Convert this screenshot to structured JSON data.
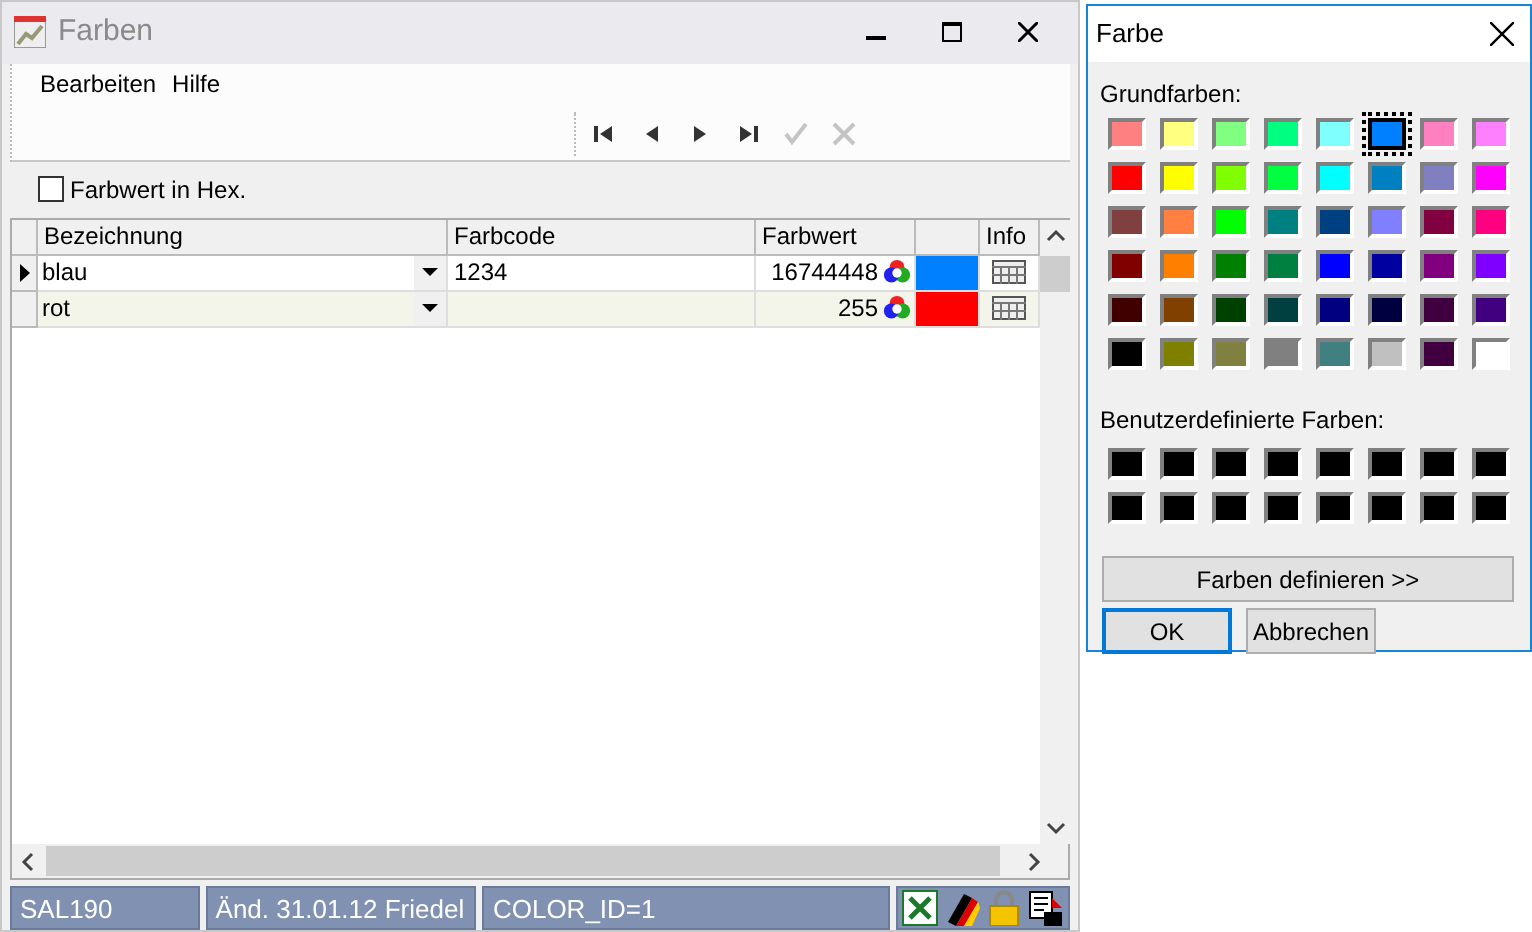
{
  "window": {
    "title": "Farben"
  },
  "menu": [
    {
      "label": "Bearbeiten"
    },
    {
      "label": "Hilfe"
    }
  ],
  "navigator": [
    {
      "kind": "first",
      "disabled": false
    },
    {
      "kind": "prev",
      "disabled": false
    },
    {
      "kind": "next",
      "disabled": false
    },
    {
      "kind": "last",
      "disabled": false
    },
    {
      "kind": "post",
      "disabled": true
    },
    {
      "kind": "cancel",
      "disabled": true
    }
  ],
  "hex_option": {
    "label": "Farbwert in Hex.",
    "checked": false
  },
  "table": {
    "columns": [
      "Bezeichnung",
      "Farbcode",
      "Farbwert",
      "Info"
    ],
    "rows": [
      {
        "name": "blau",
        "code": "1234",
        "value": "16744448",
        "color": "#0080ff",
        "selected": true
      },
      {
        "name": "rot",
        "code": "",
        "value": "255",
        "color": "#ff0000",
        "selected": false
      }
    ]
  },
  "status_bar": [
    "SAL190",
    "Änd. 31.01.12 Friedel",
    "COLOR_ID=1"
  ],
  "dialog": {
    "title": "Farbe",
    "basic_label": "Grundfarben:",
    "basic_colors": [
      {
        "color": "#ff8080",
        "selected": false
      },
      {
        "color": "#ffff80",
        "selected": false
      },
      {
        "color": "#80ff80",
        "selected": false
      },
      {
        "color": "#00ff80",
        "selected": false
      },
      {
        "color": "#80ffff",
        "selected": false
      },
      {
        "color": "#0080ff",
        "selected": true
      },
      {
        "color": "#ff80c0",
        "selected": false
      },
      {
        "color": "#ff80ff",
        "selected": false
      },
      {
        "color": "#ff0000",
        "selected": false
      },
      {
        "color": "#ffff00",
        "selected": false
      },
      {
        "color": "#80ff00",
        "selected": false
      },
      {
        "color": "#00ff40",
        "selected": false
      },
      {
        "color": "#00ffff",
        "selected": false
      },
      {
        "color": "#0080c0",
        "selected": false
      },
      {
        "color": "#8080c0",
        "selected": false
      },
      {
        "color": "#ff00ff",
        "selected": false
      },
      {
        "color": "#804040",
        "selected": false
      },
      {
        "color": "#ff8040",
        "selected": false
      },
      {
        "color": "#00ff00",
        "selected": false
      },
      {
        "color": "#008080",
        "selected": false
      },
      {
        "color": "#004080",
        "selected": false
      },
      {
        "color": "#8080ff",
        "selected": false
      },
      {
        "color": "#800040",
        "selected": false
      },
      {
        "color": "#ff0080",
        "selected": false
      },
      {
        "color": "#800000",
        "selected": false
      },
      {
        "color": "#ff8000",
        "selected": false
      },
      {
        "color": "#008000",
        "selected": false
      },
      {
        "color": "#008040",
        "selected": false
      },
      {
        "color": "#0000ff",
        "selected": false
      },
      {
        "color": "#0000a0",
        "selected": false
      },
      {
        "color": "#800080",
        "selected": false
      },
      {
        "color": "#8000ff",
        "selected": false
      },
      {
        "color": "#400000",
        "selected": false
      },
      {
        "color": "#804000",
        "selected": false
      },
      {
        "color": "#004000",
        "selected": false
      },
      {
        "color": "#004040",
        "selected": false
      },
      {
        "color": "#000080",
        "selected": false
      },
      {
        "color": "#000040",
        "selected": false
      },
      {
        "color": "#400040",
        "selected": false
      },
      {
        "color": "#400080",
        "selected": false
      },
      {
        "color": "#000000",
        "selected": false
      },
      {
        "color": "#808000",
        "selected": false
      },
      {
        "color": "#808040",
        "selected": false
      },
      {
        "color": "#808080",
        "selected": false
      },
      {
        "color": "#408080",
        "selected": false
      },
      {
        "color": "#c0c0c0",
        "selected": false
      },
      {
        "color": "#400040",
        "selected": false
      },
      {
        "color": "#ffffff",
        "selected": false
      }
    ],
    "custom_label": "Benutzerdefinierte Farben:",
    "custom_colors": [
      {
        "color": "#000000"
      },
      {
        "color": "#000000"
      },
      {
        "color": "#000000"
      },
      {
        "color": "#000000"
      },
      {
        "color": "#000000"
      },
      {
        "color": "#000000"
      },
      {
        "color": "#000000"
      },
      {
        "color": "#000000"
      },
      {
        "color": "#000000"
      },
      {
        "color": "#000000"
      },
      {
        "color": "#000000"
      },
      {
        "color": "#000000"
      },
      {
        "color": "#000000"
      },
      {
        "color": "#000000"
      },
      {
        "color": "#000000"
      },
      {
        "color": "#000000"
      }
    ],
    "define_button": "Farben definieren >>",
    "ok_button": "OK",
    "cancel_button": "Abbrechen"
  }
}
